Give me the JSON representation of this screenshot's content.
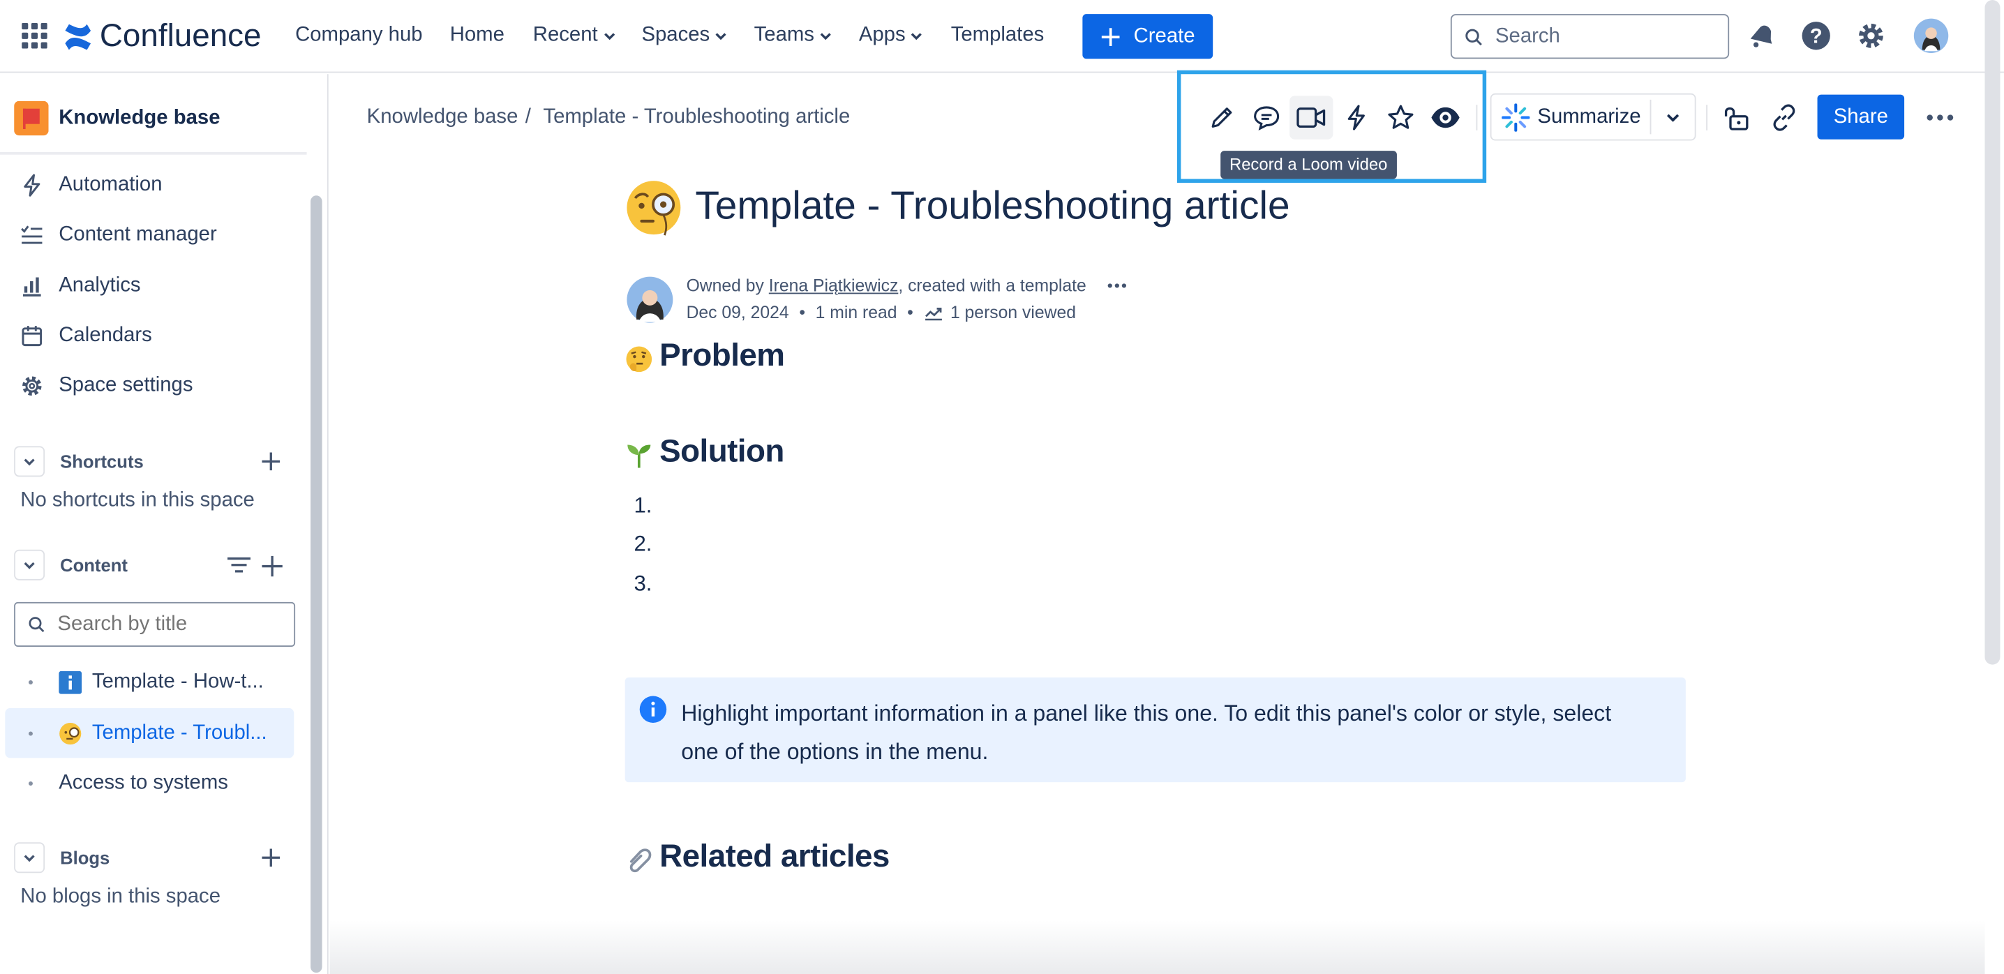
{
  "nav": {
    "app_name": "Confluence",
    "items": [
      {
        "label": "Company hub",
        "dropdown": false
      },
      {
        "label": "Home",
        "dropdown": false
      },
      {
        "label": "Recent",
        "dropdown": true
      },
      {
        "label": "Spaces",
        "dropdown": true
      },
      {
        "label": "Teams",
        "dropdown": true
      },
      {
        "label": "Apps",
        "dropdown": true
      },
      {
        "label": "Templates",
        "dropdown": false
      }
    ],
    "create_label": "Create",
    "search_placeholder": "Search"
  },
  "sidebar": {
    "space_name": "Knowledge base",
    "items": [
      {
        "label": "Automation",
        "icon": "lightning-icon"
      },
      {
        "label": "Content manager",
        "icon": "checklist-icon"
      },
      {
        "label": "Analytics",
        "icon": "bar-chart-icon"
      },
      {
        "label": "Calendars",
        "icon": "calendar-icon"
      },
      {
        "label": "Space settings",
        "icon": "gear-icon"
      }
    ],
    "shortcuts": {
      "title": "Shortcuts",
      "empty_text": "No shortcuts in this space"
    },
    "content": {
      "title": "Content",
      "search_placeholder": "Search by title",
      "tree": [
        {
          "label": "Template - How-t...",
          "icon": "info-icon",
          "selected": false
        },
        {
          "label": "Template - Troubl...",
          "icon": "monocle-face-emoji",
          "selected": true
        },
        {
          "label": "Access to systems",
          "icon": "",
          "selected": false
        }
      ]
    },
    "blogs": {
      "title": "Blogs",
      "empty_text": "No blogs in this space"
    }
  },
  "page_header": {
    "breadcrumb": [
      "Knowledge base",
      "/",
      "Template - Troubleshooting article"
    ],
    "tooltip": "Record a Loom video",
    "summarize_label": "Summarize",
    "share_label": "Share"
  },
  "page": {
    "title": "Template - Troubleshooting article",
    "owned_by_prefix": "Owned by ",
    "owner": "Irena Piątkiewicz",
    "owned_by_suffix": ", created with a template",
    "date": "Dec 09, 2024",
    "read_time": "1 min read",
    "viewed": "1 person viewed",
    "sections": {
      "problem": "Problem",
      "solution": "Solution",
      "related": "Related articles"
    },
    "list_items": [
      "1.",
      "2.",
      "3."
    ],
    "panel_text": "Highlight important information in a panel like this one. To edit this panel's color or style, select one of the options in the menu."
  },
  "colors": {
    "brand_blue": "#0c66e4",
    "highlight_border": "#2da3ea",
    "panel_bg": "#e9f2ff"
  }
}
